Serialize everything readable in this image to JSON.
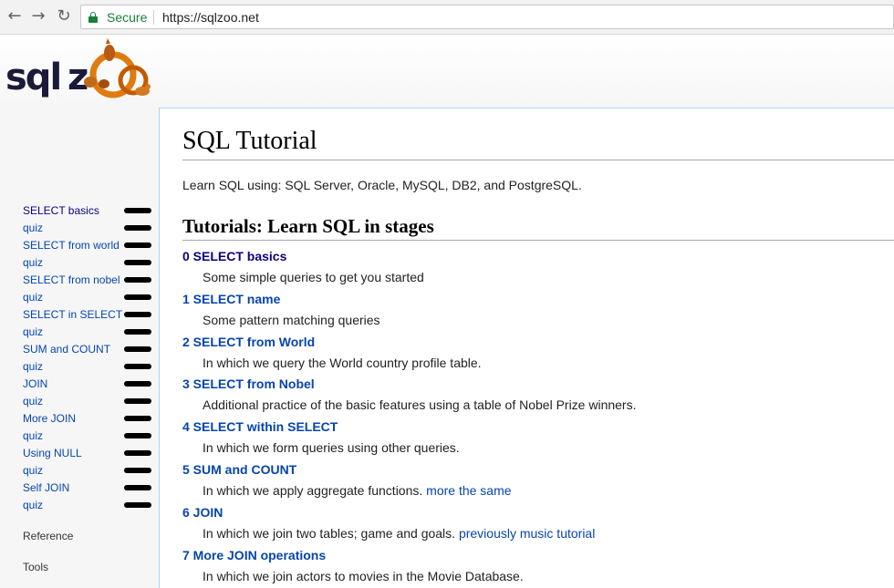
{
  "browser": {
    "secure_label": "Secure",
    "url": "https://sqlzoo.net"
  },
  "logo": {
    "text": "sqlzoo"
  },
  "sidebar": {
    "items": [
      {
        "label": "SELECT basics",
        "visited": true
      },
      {
        "label": "quiz"
      },
      {
        "label": "SELECT from world"
      },
      {
        "label": "quiz"
      },
      {
        "label": "SELECT from nobel"
      },
      {
        "label": "quiz"
      },
      {
        "label": "SELECT in SELECT"
      },
      {
        "label": "quiz"
      },
      {
        "label": "SUM and COUNT"
      },
      {
        "label": "quiz"
      },
      {
        "label": "JOIN"
      },
      {
        "label": "quiz"
      },
      {
        "label": "More JOIN"
      },
      {
        "label": "quiz"
      },
      {
        "label": "Using NULL"
      },
      {
        "label": "quiz"
      },
      {
        "label": "Self JOIN"
      },
      {
        "label": "quiz"
      }
    ],
    "reference": "Reference",
    "tools": "Tools"
  },
  "main": {
    "title": "SQL Tutorial",
    "intro": "Learn SQL using: SQL Server, Oracle, MySQL, DB2, and PostgreSQL.",
    "section_title": "Tutorials: Learn SQL in stages",
    "tutorials": [
      {
        "title": "0 SELECT basics",
        "desc": "Some simple queries to get you started",
        "extra": "",
        "visited": true
      },
      {
        "title": "1 SELECT name",
        "desc": "Some pattern matching queries",
        "extra": ""
      },
      {
        "title": "2 SELECT from World",
        "desc": "In which we query the World country profile table.",
        "extra": ""
      },
      {
        "title": "3 SELECT from Nobel",
        "desc": "Additional practice of the basic features using a table of Nobel Prize winners.",
        "extra": ""
      },
      {
        "title": "4 SELECT within SELECT",
        "desc": "In which we form queries using other queries.",
        "extra": ""
      },
      {
        "title": "5 SUM and COUNT",
        "desc": "In which we apply aggregate functions.",
        "extra": "more the same"
      },
      {
        "title": "6 JOIN",
        "desc": "In which we join two tables; game and goals.",
        "extra": "previously music tutorial"
      },
      {
        "title": "7 More JOIN operations",
        "desc": "In which we join actors to movies in the Movie Database.",
        "extra": ""
      }
    ]
  },
  "colors": {
    "link": "#0645ad",
    "visited": "#0b0080",
    "secure": "#188038"
  }
}
